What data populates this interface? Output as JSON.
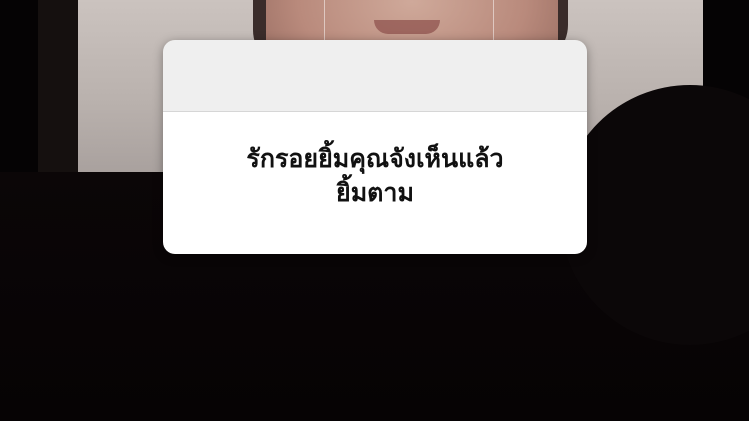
{
  "card": {
    "text_lines": [
      "รักรอยยิ้มคุณจังเห็นแล้ว",
      "ยิ้มตาม"
    ]
  }
}
